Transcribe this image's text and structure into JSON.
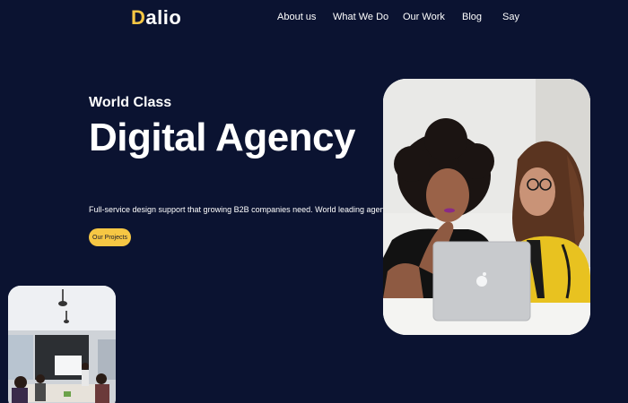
{
  "brand": {
    "logo_first": "D",
    "logo_rest": "alio",
    "accent_color": "#f6c744",
    "background_color": "#0b1331"
  },
  "nav": {
    "items": [
      {
        "label": "About us"
      },
      {
        "label": "What We Do"
      },
      {
        "label": "Our Work"
      },
      {
        "label": "Blog"
      },
      {
        "label": "Say"
      }
    ]
  },
  "hero": {
    "eyebrow": "World Class",
    "title": "Digital Agency",
    "description": "Full-service design support that growing B2B companies need. World leading agency.",
    "cta_label": "Our Projects"
  }
}
